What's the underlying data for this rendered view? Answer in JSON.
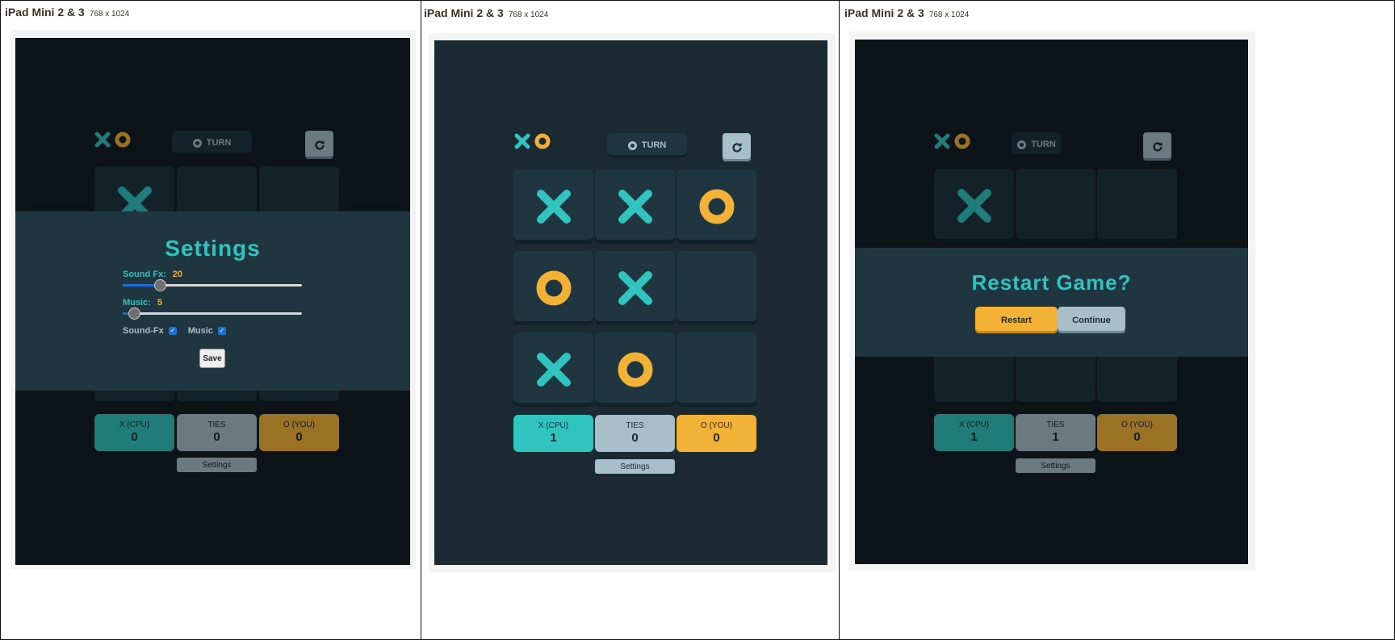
{
  "device": {
    "name": "iPad Mini 2 & 3",
    "size": "768 x 1024"
  },
  "colors": {
    "x": "#31c3bd",
    "o": "#f2b137",
    "silver": "#a8bfc9",
    "navy": "#1a2a33",
    "semi_navy": "#1f3641"
  },
  "turn_label": "TURN",
  "score_labels": {
    "x": "X (CPU)",
    "ties": "TIES",
    "o": "O (YOU)"
  },
  "settings_button_label": "Settings",
  "panels": [
    {
      "board": [
        "x",
        "",
        "",
        "",
        "",
        "",
        "",
        "",
        ""
      ],
      "scores": {
        "x": "0",
        "ties": "0",
        "o": "0"
      },
      "overlay": "settings"
    },
    {
      "board": [
        "x",
        "x",
        "o",
        "o",
        "x",
        "",
        "x",
        "o",
        ""
      ],
      "scores": {
        "x": "1",
        "ties": "0",
        "o": "0"
      },
      "overlay": ""
    },
    {
      "board": [
        "x",
        "",
        "",
        "",
        "",
        "",
        "",
        "",
        ""
      ],
      "scores": {
        "x": "1",
        "ties": "1",
        "o": "0"
      },
      "overlay": "restart"
    }
  ],
  "settings_modal": {
    "title": "Settings",
    "sound_fx_label": "Sound Fx:",
    "sound_fx_value": "20",
    "sound_fx_level": 0.2,
    "music_label": "Music:",
    "music_value": "5",
    "music_level": 0.05,
    "sound_fx_checkbox_label": "Sound-Fx",
    "music_checkbox_label": "Music",
    "save_label": "Save"
  },
  "restart_modal": {
    "title": "Restart Game?",
    "restart_label": "Restart",
    "continue_label": "Continue"
  }
}
